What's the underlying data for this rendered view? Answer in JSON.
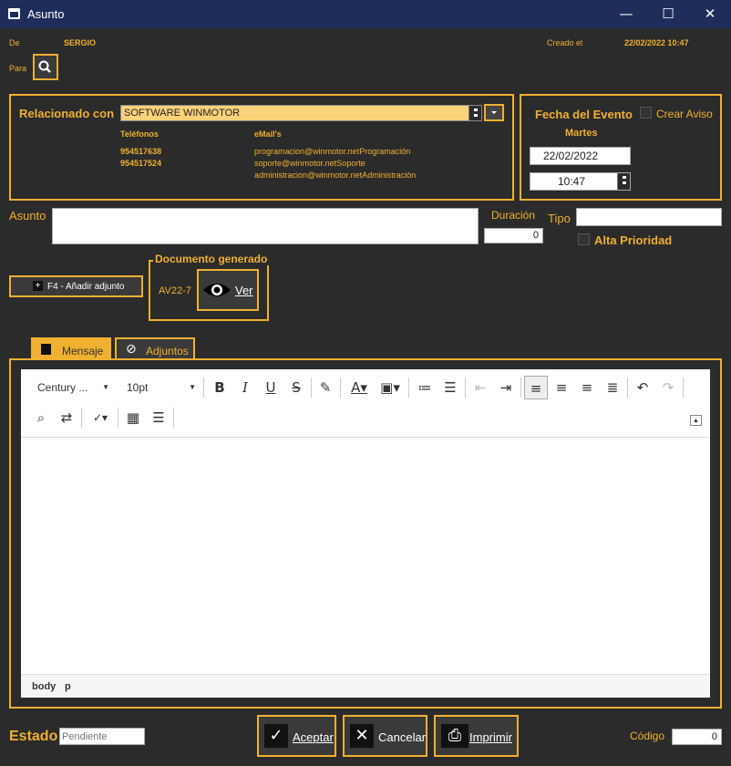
{
  "window": {
    "title": "Asunto",
    "minimize": "—",
    "maximize": "☐",
    "close": "✕"
  },
  "header": {
    "de_label": "De",
    "de_value": "SERGIO",
    "creado_label": "Creado el",
    "creado_value": "22/02/2022 10:47",
    "para_label": "Para"
  },
  "related": {
    "label": "Relacionado con",
    "value": "SOFTWARE WINMOTOR",
    "phones_header": "Teléfonos",
    "emails_header": "eMail's",
    "phones": [
      "954517638",
      "954517524",
      ""
    ],
    "emails": [
      "programacion@winmotor.netProgramación",
      "soporte@winmotor.netSoporte",
      "administracion@winmotor.netAdministración"
    ]
  },
  "event": {
    "label": "Fecha del Evento",
    "aviso_label": "Crear Aviso",
    "day": "Martes",
    "date": "22/02/2022",
    "time": "10:47"
  },
  "subject": {
    "asunto_label": "Asunto",
    "asunto_value": "",
    "duracion_label": "Duración",
    "duracion_value": "0",
    "tipo_label": "Tipo",
    "tipo_value": "",
    "prioridad_label": "Alta Prioridad"
  },
  "attach": {
    "add_label": "F4 - Añadir adjunto"
  },
  "document": {
    "label": "Documento generado",
    "code": "AV22-7",
    "ver_label": "Ver"
  },
  "tabs": {
    "mensaje": "Mensaje",
    "adjuntos": "Adjuntos"
  },
  "editor": {
    "font": "Century ...",
    "size": "10pt",
    "status_body": "body",
    "status_p": "p"
  },
  "footer": {
    "estado_label": "Estado",
    "estado_placeholder": "Pendiente",
    "aceptar": "Aceptar",
    "cancelar": "Cancelar",
    "imprimir": "Imprimir",
    "codigo_label": "Código",
    "codigo_value": "0"
  },
  "colors": {
    "accent": "#f0b030",
    "background": "#2b2b2b",
    "titlebar": "#1e2d5a"
  }
}
